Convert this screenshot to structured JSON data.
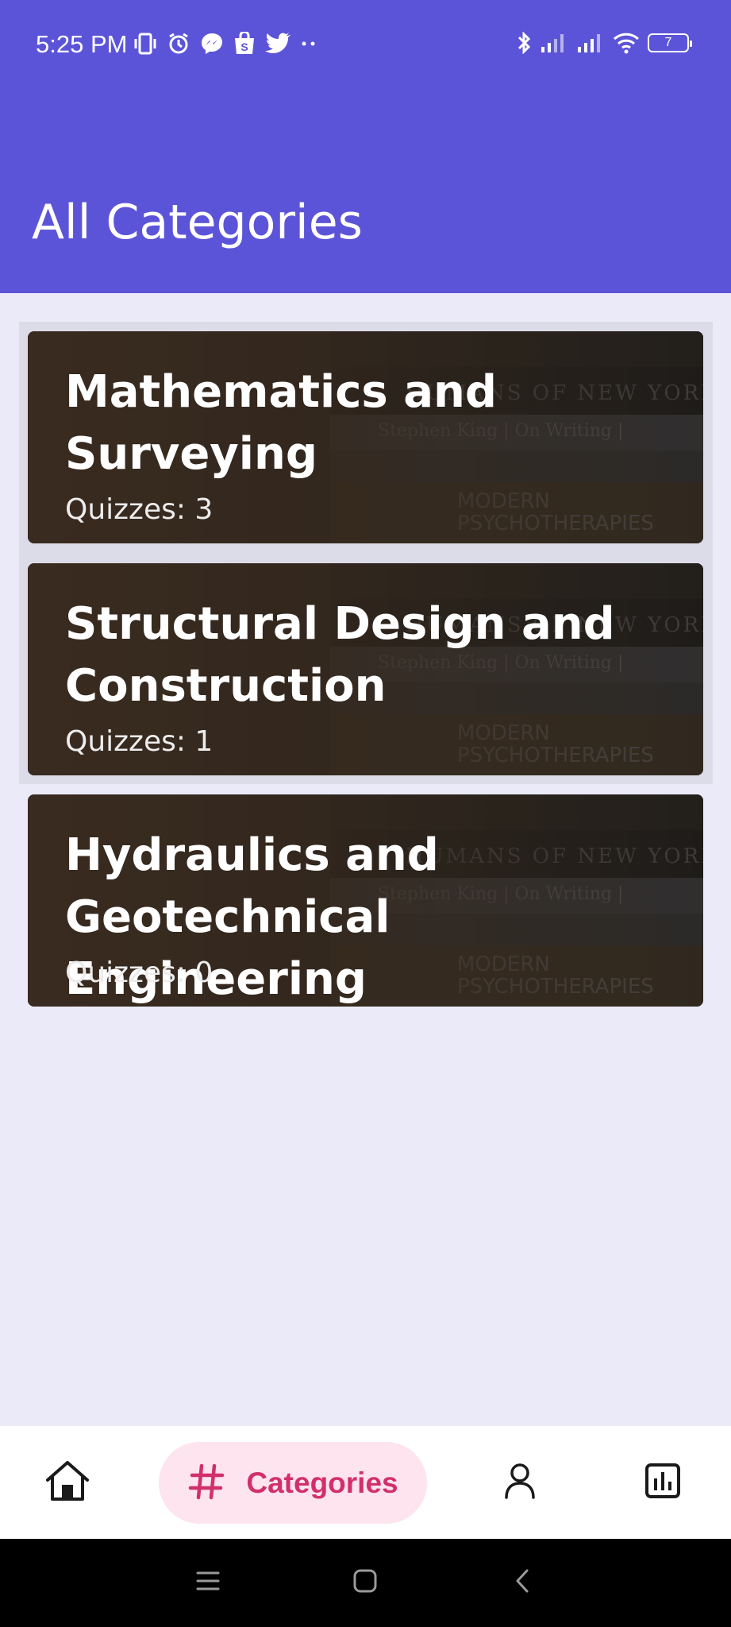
{
  "status_bar": {
    "time": "5:25 PM",
    "battery_level": "7",
    "left_icons": [
      "vibrate-icon",
      "alarm-icon",
      "messenger-icon",
      "shop-icon",
      "twitter-icon",
      "more-dots-icon"
    ],
    "right_icons": [
      "bluetooth-icon",
      "signal-icon",
      "signal-icon",
      "wifi-icon",
      "battery-icon"
    ]
  },
  "header": {
    "title": "All Categories",
    "background_color": "#5c54d8"
  },
  "categories": [
    {
      "title": "Mathematics and Surveying",
      "count_label": "Quizzes: 3"
    },
    {
      "title": "Structural Design and Construction",
      "count_label": "Quizzes: 1"
    },
    {
      "title": "Hydraulics and Geotechnical Engineering",
      "count_label": "Quizzes: 0"
    }
  ],
  "bottom_nav": {
    "items": [
      {
        "icon": "home-icon",
        "label": ""
      },
      {
        "icon": "hashtag-icon",
        "label": "Categories",
        "active": true
      },
      {
        "icon": "user-icon",
        "label": ""
      },
      {
        "icon": "bar-chart-icon",
        "label": ""
      }
    ],
    "active_color": "#d1306b",
    "active_background": "#fde4ee"
  },
  "system_nav": {
    "buttons": [
      "menu-icon",
      "home-square-icon",
      "back-icon"
    ]
  }
}
